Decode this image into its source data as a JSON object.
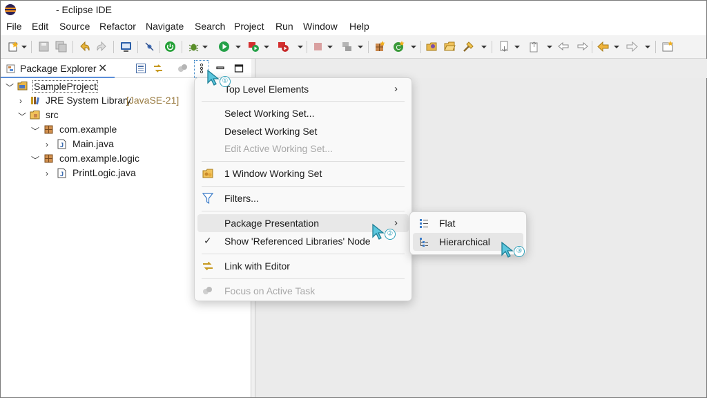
{
  "window": {
    "title": "- Eclipse IDE"
  },
  "menubar": {
    "items": [
      "File",
      "Edit",
      "Source",
      "Refactor",
      "Navigate",
      "Search",
      "Project",
      "Run",
      "Window",
      "Help"
    ]
  },
  "explorer": {
    "tab_label": "Package Explorer",
    "tree": [
      {
        "label": "SampleProject",
        "expanded": true
      },
      {
        "label": "JRE System Library",
        "decoration": "[JavaSE-21]",
        "expanded": false
      },
      {
        "label": "src",
        "expanded": true
      },
      {
        "label": "com.example",
        "expanded": true
      },
      {
        "label": "Main.java",
        "expanded": false
      },
      {
        "label": "com.example.logic",
        "expanded": true
      },
      {
        "label": "PrintLogic.java",
        "expanded": false
      }
    ]
  },
  "context_menu": {
    "items": [
      {
        "label": "Top Level Elements",
        "has_submenu": true
      },
      {
        "label": "Select Working Set..."
      },
      {
        "label": "Deselect Working Set"
      },
      {
        "label": "Edit Active Working Set...",
        "disabled": true
      },
      {
        "label": "1 Window Working Set"
      },
      {
        "label": "Filters..."
      },
      {
        "label": "Package Presentation",
        "has_submenu": true,
        "highlighted": true
      },
      {
        "label": "Show 'Referenced Libraries' Node",
        "checked": true
      },
      {
        "label": "Link with Editor"
      },
      {
        "label": "Focus on Active Task",
        "disabled": true
      }
    ]
  },
  "submenu": {
    "items": [
      {
        "label": "Flat"
      },
      {
        "label": "Hierarchical",
        "highlighted": true
      }
    ]
  },
  "annotations": {
    "steps": [
      "①",
      "②",
      "③"
    ],
    "accent_color": "#2d9fb8"
  }
}
